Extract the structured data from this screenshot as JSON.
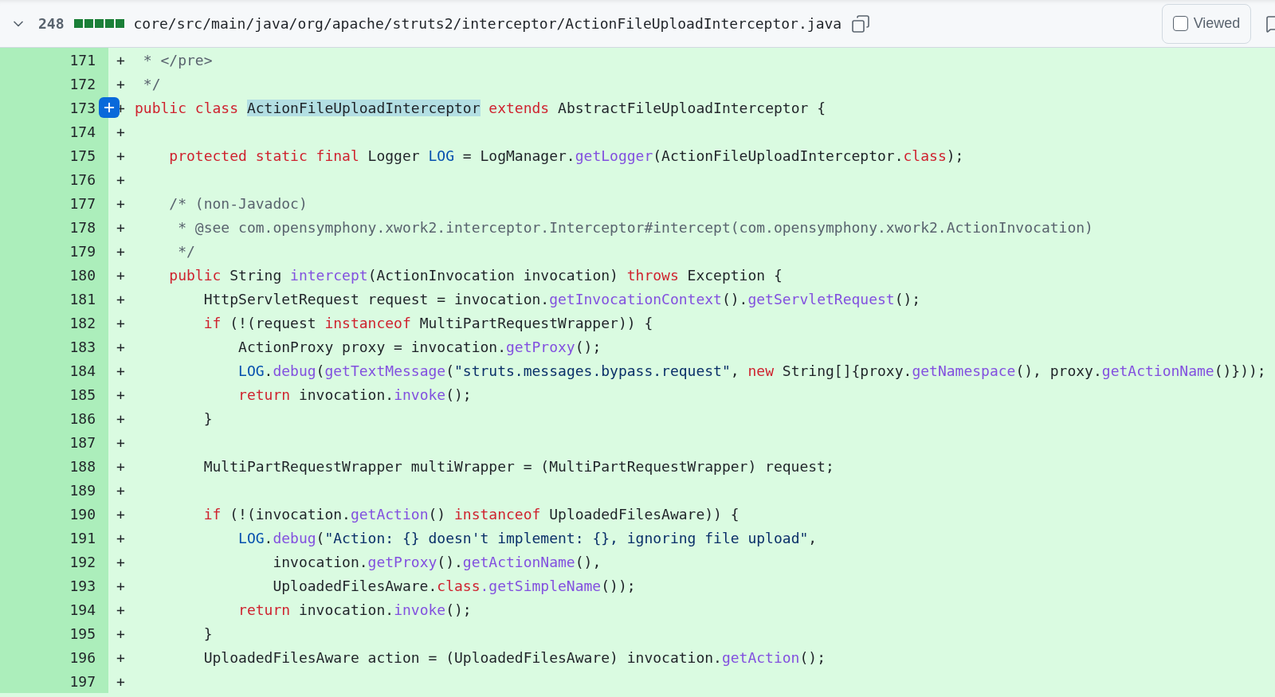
{
  "file_header": {
    "expanded": true,
    "changes": "248",
    "path": "core/src/main/java/org/apache/struts2/interceptor/ActionFileUploadInterceptor.java",
    "viewed": {
      "label": "Viewed",
      "checked": false
    }
  },
  "lines": [
    {
      "number": "171",
      "sign": "+",
      "hovered": false,
      "tokens": [
        {
          "kind": "comment",
          "text": " * </pre>"
        }
      ]
    },
    {
      "number": "172",
      "sign": "+",
      "hovered": false,
      "tokens": [
        {
          "kind": "comment",
          "text": " */"
        }
      ]
    },
    {
      "number": "173",
      "sign": "+",
      "hovered": true,
      "tokens": [
        {
          "kind": "keyword",
          "text": "public class "
        },
        {
          "kind": "highlight",
          "text": "ActionFileUploadInterceptor"
        },
        {
          "kind": "keyword",
          "text": " extends"
        },
        {
          "kind": "plain",
          "text": " AbstractFileUploadInterceptor {"
        }
      ]
    },
    {
      "number": "174",
      "sign": "+",
      "hovered": false
    },
    {
      "number": "175",
      "sign": "+",
      "hovered": false,
      "tokens": [
        {
          "kind": "keyword",
          "text": "    protected static final"
        },
        {
          "kind": "plain",
          "text": " Logger "
        },
        {
          "kind": "constant",
          "text": "LOG"
        },
        {
          "kind": "plain",
          "text": " = LogManager."
        },
        {
          "kind": "function",
          "text": "getLogger"
        },
        {
          "kind": "plain",
          "text": "(ActionFileUploadInterceptor."
        },
        {
          "kind": "keyword",
          "text": "class"
        },
        {
          "kind": "plain",
          "text": ");"
        }
      ]
    },
    {
      "number": "176",
      "sign": "+",
      "hovered": false
    },
    {
      "number": "177",
      "sign": "+",
      "hovered": false,
      "tokens": [
        {
          "kind": "comment",
          "text": "    /* (non-Javadoc)"
        }
      ]
    },
    {
      "number": "178",
      "sign": "+",
      "hovered": false,
      "tokens": [
        {
          "kind": "comment",
          "text": "     * @see com.opensymphony.xwork2.interceptor.Interceptor#intercept(com.opensymphony.xwork2.ActionInvocation)"
        }
      ]
    },
    {
      "number": "179",
      "sign": "+",
      "hovered": false,
      "tokens": [
        {
          "kind": "comment",
          "text": "     */"
        }
      ]
    },
    {
      "number": "180",
      "sign": "+",
      "hovered": false,
      "tokens": [
        {
          "kind": "keyword",
          "text": "    public"
        },
        {
          "kind": "plain",
          "text": " String "
        },
        {
          "kind": "function",
          "text": "intercept"
        },
        {
          "kind": "plain",
          "text": "(ActionInvocation invocation) "
        },
        {
          "kind": "keyword",
          "text": "throws"
        },
        {
          "kind": "plain",
          "text": " Exception {"
        }
      ]
    },
    {
      "number": "181",
      "sign": "+",
      "hovered": false,
      "tokens": [
        {
          "kind": "plain",
          "text": "        HttpServletRequest request = invocation."
        },
        {
          "kind": "function",
          "text": "getInvocationContext"
        },
        {
          "kind": "plain",
          "text": "()."
        },
        {
          "kind": "function",
          "text": "getServletRequest"
        },
        {
          "kind": "plain",
          "text": "();"
        }
      ]
    },
    {
      "number": "182",
      "sign": "+",
      "hovered": false,
      "tokens": [
        {
          "kind": "keyword",
          "text": "        if"
        },
        {
          "kind": "plain",
          "text": " (!(request "
        },
        {
          "kind": "keyword",
          "text": "instanceof"
        },
        {
          "kind": "plain",
          "text": " MultiPartRequestWrapper)) {"
        }
      ]
    },
    {
      "number": "183",
      "sign": "+",
      "hovered": false,
      "tokens": [
        {
          "kind": "plain",
          "text": "            ActionProxy proxy = invocation."
        },
        {
          "kind": "function",
          "text": "getProxy"
        },
        {
          "kind": "plain",
          "text": "();"
        }
      ]
    },
    {
      "number": "184",
      "sign": "+",
      "hovered": false,
      "tokens": [
        {
          "kind": "constant",
          "text": "            LOG"
        },
        {
          "kind": "plain",
          "text": "."
        },
        {
          "kind": "function",
          "text": "debug"
        },
        {
          "kind": "plain",
          "text": "("
        },
        {
          "kind": "function",
          "text": "getTextMessage"
        },
        {
          "kind": "plain",
          "text": "("
        },
        {
          "kind": "string",
          "text": "\"struts.messages.bypass.request\""
        },
        {
          "kind": "plain",
          "text": ", "
        },
        {
          "kind": "keyword",
          "text": "new"
        },
        {
          "kind": "plain",
          "text": " String[]{proxy."
        },
        {
          "kind": "function",
          "text": "getNamespace"
        },
        {
          "kind": "plain",
          "text": "(), proxy."
        },
        {
          "kind": "function",
          "text": "getActionName"
        },
        {
          "kind": "plain",
          "text": "()}));"
        }
      ]
    },
    {
      "number": "185",
      "sign": "+",
      "hovered": false,
      "tokens": [
        {
          "kind": "keyword",
          "text": "            return"
        },
        {
          "kind": "plain",
          "text": " invocation."
        },
        {
          "kind": "function",
          "text": "invoke"
        },
        {
          "kind": "plain",
          "text": "();"
        }
      ]
    },
    {
      "number": "186",
      "sign": "+",
      "hovered": false,
      "tokens": [
        {
          "kind": "plain",
          "text": "        }"
        }
      ]
    },
    {
      "number": "187",
      "sign": "+",
      "hovered": false
    },
    {
      "number": "188",
      "sign": "+",
      "hovered": false,
      "tokens": [
        {
          "kind": "plain",
          "text": "        MultiPartRequestWrapper multiWrapper = (MultiPartRequestWrapper) request;"
        }
      ]
    },
    {
      "number": "189",
      "sign": "+",
      "hovered": false
    },
    {
      "number": "190",
      "sign": "+",
      "hovered": false,
      "tokens": [
        {
          "kind": "keyword",
          "text": "        if"
        },
        {
          "kind": "plain",
          "text": " (!(invocation."
        },
        {
          "kind": "function",
          "text": "getAction"
        },
        {
          "kind": "plain",
          "text": "() "
        },
        {
          "kind": "keyword",
          "text": "instanceof"
        },
        {
          "kind": "plain",
          "text": " UploadedFilesAware)) {"
        }
      ]
    },
    {
      "number": "191",
      "sign": "+",
      "hovered": false,
      "tokens": [
        {
          "kind": "constant",
          "text": "            LOG"
        },
        {
          "kind": "plain",
          "text": "."
        },
        {
          "kind": "function",
          "text": "debug"
        },
        {
          "kind": "plain",
          "text": "("
        },
        {
          "kind": "string",
          "text": "\"Action: {} doesn't implement: {}, ignoring file upload\""
        },
        {
          "kind": "plain",
          "text": ","
        }
      ]
    },
    {
      "number": "192",
      "sign": "+",
      "hovered": false,
      "tokens": [
        {
          "kind": "plain",
          "text": "                invocation."
        },
        {
          "kind": "function",
          "text": "getProxy"
        },
        {
          "kind": "plain",
          "text": "()."
        },
        {
          "kind": "function",
          "text": "getActionName"
        },
        {
          "kind": "plain",
          "text": "(),"
        }
      ]
    },
    {
      "number": "193",
      "sign": "+",
      "hovered": false,
      "tokens": [
        {
          "kind": "plain",
          "text": "                UploadedFilesAware."
        },
        {
          "kind": "keyword",
          "text": "class"
        },
        {
          "kind": "function",
          "text": ".getSimpleName"
        },
        {
          "kind": "plain",
          "text": "());"
        }
      ]
    },
    {
      "number": "194",
      "sign": "+",
      "hovered": false,
      "tokens": [
        {
          "kind": "keyword",
          "text": "            return"
        },
        {
          "kind": "plain",
          "text": " invocation."
        },
        {
          "kind": "function",
          "text": "invoke"
        },
        {
          "kind": "plain",
          "text": "();"
        }
      ]
    },
    {
      "number": "195",
      "sign": "+",
      "hovered": false,
      "tokens": [
        {
          "kind": "plain",
          "text": "        }"
        }
      ]
    },
    {
      "number": "196",
      "sign": "+",
      "hovered": false,
      "tokens": [
        {
          "kind": "plain",
          "text": "        UploadedFilesAware action = (UploadedFilesAware) invocation."
        },
        {
          "kind": "function",
          "text": "getAction"
        },
        {
          "kind": "plain",
          "text": "();"
        }
      ]
    },
    {
      "number": "197",
      "sign": "+",
      "hovered": false
    }
  ]
}
